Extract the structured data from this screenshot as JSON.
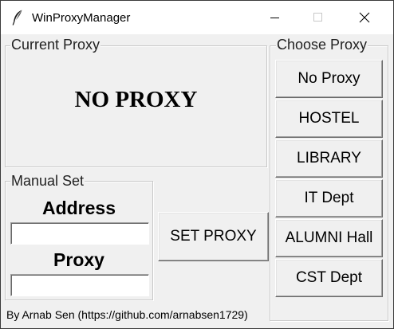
{
  "window": {
    "title": "WinProxyManager",
    "icon": "feather-icon"
  },
  "current_proxy": {
    "label": "Current Proxy",
    "status": "NO PROXY"
  },
  "choose_proxy": {
    "label": "Choose Proxy",
    "options": [
      "No Proxy",
      "HOSTEL",
      "LIBRARY",
      "IT Dept",
      "ALUMNI Hall",
      "CST Dept"
    ]
  },
  "manual_set": {
    "label": "Manual Set",
    "address_label": "Address",
    "address_value": "",
    "proxy_label": "Proxy",
    "proxy_value": "",
    "set_button": "SET PROXY"
  },
  "footer": {
    "credit": "By Arnab Sen (https://github.com/arnabsen1729)"
  }
}
